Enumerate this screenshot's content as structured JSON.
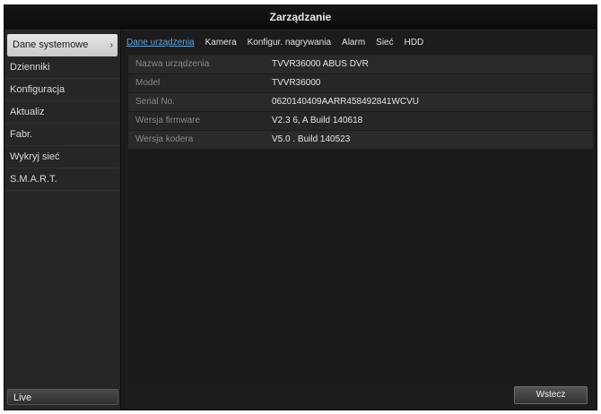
{
  "window": {
    "title": "Zarządzanie"
  },
  "sidebar": {
    "items": [
      {
        "label": "Dane systemowe",
        "active": true
      },
      {
        "label": "Dzienniki"
      },
      {
        "label": "Konfiguracja"
      },
      {
        "label": "Aktualiz"
      },
      {
        "label": "Fabr."
      },
      {
        "label": "Wykryj sieć"
      },
      {
        "label": "S.M.A.R.T."
      }
    ],
    "live_label": "Live",
    "chevron": "›"
  },
  "tabs": [
    {
      "label": "Dane urządzenia",
      "active": true
    },
    {
      "label": "Kamera"
    },
    {
      "label": "Konfigur. nagrywania"
    },
    {
      "label": "Alarm"
    },
    {
      "label": "Sieć"
    },
    {
      "label": "HDD"
    }
  ],
  "device_info": [
    {
      "label": "Nazwa urządzenia",
      "value": "TVVR36000 ABUS DVR"
    },
    {
      "label": "Model",
      "value": "TVVR36000"
    },
    {
      "label": "Serial No.",
      "value": "0620140409AARR458492841WCVU"
    },
    {
      "label": "Wersja firmware",
      "value": "V2.3 6, A Build 140618"
    },
    {
      "label": "Wersja kodera",
      "value": "V5.0 . Build 140523"
    }
  ],
  "footer": {
    "back_label": "Wstecz"
  }
}
